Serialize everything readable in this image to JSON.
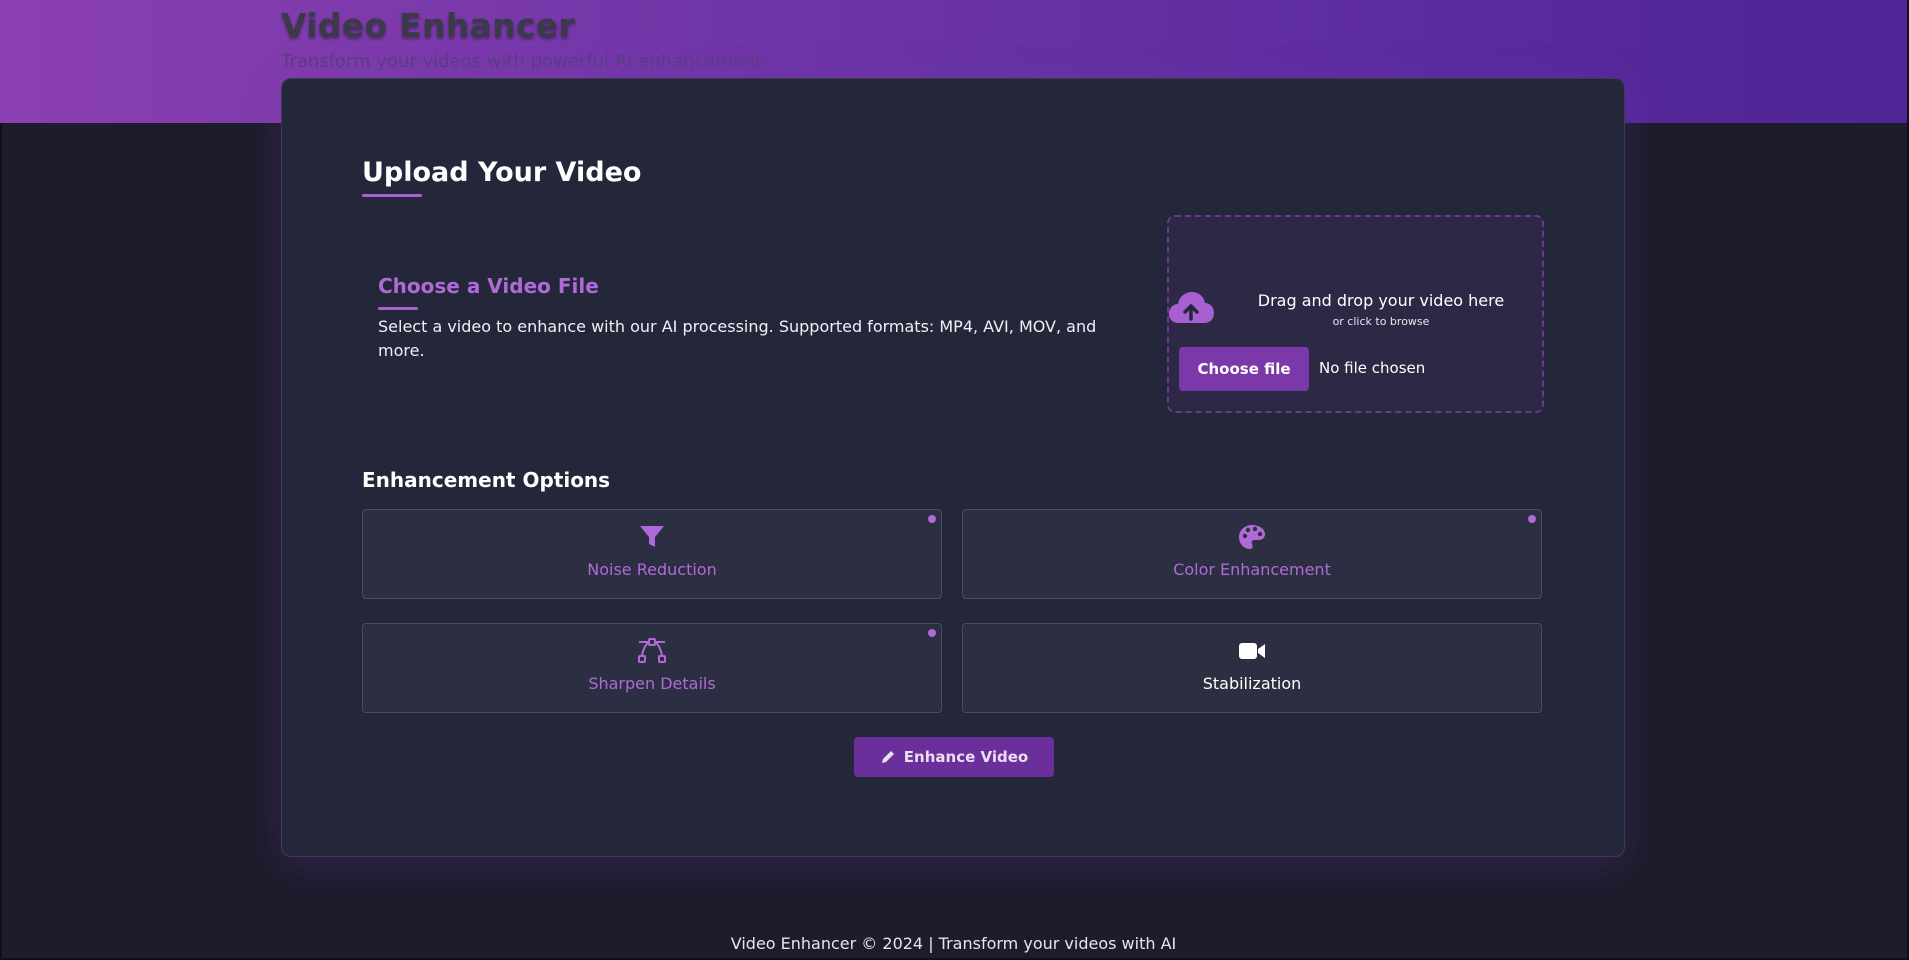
{
  "header": {
    "title": "Video Enhancer",
    "subtitle": "Transform your videos with powerful AI enhancement"
  },
  "upload": {
    "section_title": "Upload Your Video",
    "choose_title": "Choose a Video File",
    "choose_description": "Select a video to enhance with our AI processing. Supported formats: MP4, AVI, MOV, and more.",
    "dropzone": {
      "title": "Drag and drop your video here",
      "subtitle": "or click to browse",
      "button_label": "Choose file",
      "file_status": "No file chosen",
      "icon": "cloud-upload-icon"
    }
  },
  "options": {
    "title": "Enhancement Options",
    "items": [
      {
        "label": "Noise Reduction",
        "icon": "filter-icon",
        "selected": true
      },
      {
        "label": "Color Enhancement",
        "icon": "palette-icon",
        "selected": true
      },
      {
        "label": "Sharpen Details",
        "icon": "bezier-curve-icon",
        "selected": true
      },
      {
        "label": "Stabilization",
        "icon": "video-camera-icon",
        "selected": false
      }
    ]
  },
  "actions": {
    "enhance_label": "Enhance Video",
    "enhance_icon": "pencil-icon"
  },
  "footer": {
    "text": "Video Enhancer © 2024 | Transform your videos with AI"
  },
  "colors": {
    "accent": "#b06ad8",
    "button": "#7b38a8",
    "card_bg": "#24273a",
    "page_bg": "#1c1c2b",
    "header_start": "#8b3fb0",
    "header_end": "#4e2496"
  }
}
